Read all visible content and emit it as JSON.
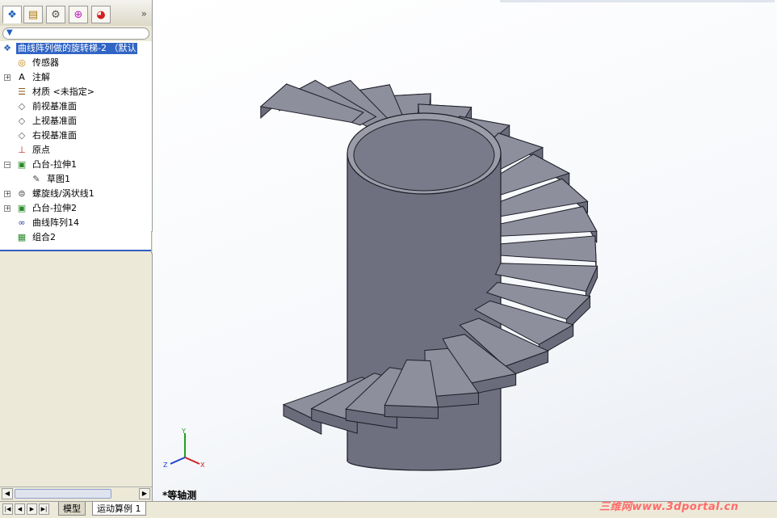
{
  "feature_tree": {
    "root": "曲线阵列做的旋转梯-2 （默认",
    "items": [
      {
        "label": "传感器",
        "icon": "sensor-icon",
        "expandable": false
      },
      {
        "label": "注解",
        "icon": "annotation-icon",
        "expandable": true
      },
      {
        "label": "材质 <未指定>",
        "icon": "material-icon",
        "expandable": false
      },
      {
        "label": "前视基准面",
        "icon": "plane-icon",
        "expandable": false
      },
      {
        "label": "上视基准面",
        "icon": "plane-icon",
        "expandable": false
      },
      {
        "label": "右视基准面",
        "icon": "plane-icon",
        "expandable": false
      },
      {
        "label": "原点",
        "icon": "origin-icon",
        "expandable": false
      },
      {
        "label": "凸台-拉伸1",
        "icon": "extrude-icon",
        "expandable": true,
        "expanded": true
      },
      {
        "label": "草图1",
        "icon": "sketch-icon",
        "expandable": false,
        "child": true
      },
      {
        "label": "螺旋线/涡状线1",
        "icon": "helix-icon",
        "expandable": true
      },
      {
        "label": "凸台-拉伸2",
        "icon": "extrude-icon",
        "expandable": true
      },
      {
        "label": "曲线阵列14",
        "icon": "curve-pattern-icon",
        "expandable": false
      },
      {
        "label": "组合2",
        "icon": "combine-icon",
        "expandable": false
      }
    ]
  },
  "tabs": {
    "expand": "»"
  },
  "viewport": {
    "view_name": "*等轴测",
    "triad": {
      "y": "Y",
      "z": "Z",
      "x": "X"
    }
  },
  "bottom_tabs": {
    "model": "模型",
    "motion": "运动算例 1"
  },
  "watermark": "三维网www.3dportal.cn",
  "colors": {
    "selection": "#3165c5",
    "model_face_top": "#8d8f9d",
    "model_face_side": "#6b6c7b",
    "model_edge": "#1e1e28"
  }
}
